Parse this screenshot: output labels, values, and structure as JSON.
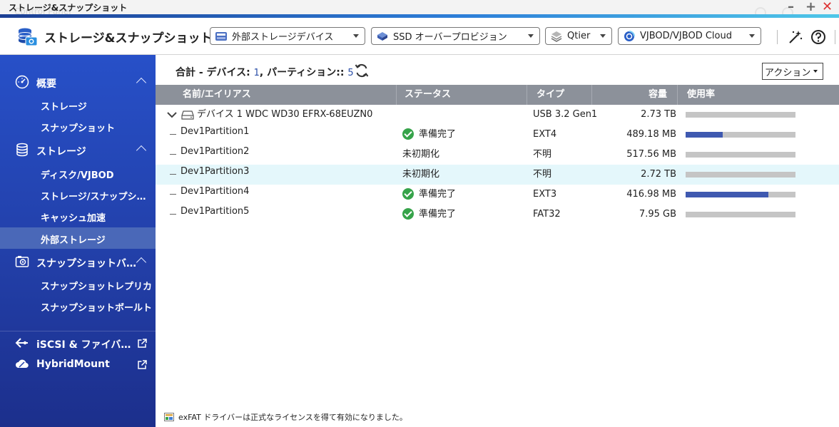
{
  "window": {
    "title": "ストレージ&スナップショット",
    "ghost_text": "Control Panel",
    "minimize": "–",
    "maximize": "+",
    "close": "✕"
  },
  "toolbar": {
    "app_name": "ストレージ&スナップショット",
    "dropdowns": [
      {
        "label": "外部ストレージデバイス",
        "icon": "external-storage-icon"
      },
      {
        "label": "SSD オーバープロビジョン",
        "icon": "ssd-icon"
      },
      {
        "label": "Qtier",
        "icon": "qtier-icon"
      },
      {
        "label": "VJBOD/VJBOD Cloud",
        "icon": "vjbod-cloud-icon"
      }
    ],
    "icons": [
      "magic-wand-icon",
      "help-icon"
    ]
  },
  "sidebar": {
    "groups": [
      {
        "label": "概要",
        "icon": "dashboard-icon",
        "items": [
          "ストレージ",
          "スナップショット"
        ]
      },
      {
        "label": "ストレージ",
        "icon": "database-icon",
        "items": [
          "ディスク/VJBOD",
          "ストレージ/スナップショット",
          "キャッシュ加速",
          "外部ストレージ"
        ]
      },
      {
        "label": "スナップショットバックアップ",
        "icon": "snapshot-camera-icon",
        "items": [
          "スナップショットレプリカ",
          "スナップショットボールト"
        ]
      }
    ],
    "active_item": "外部ストレージ",
    "links": [
      {
        "label": "iSCSI & ファイバーチャネル",
        "icon": "iscsi-icon"
      },
      {
        "label": "HybridMount",
        "icon": "cloud-icon"
      }
    ]
  },
  "summary": {
    "prefix": "合計 - デバイス:",
    "devices": "1",
    "sep": ", パーティション:",
    "colon": ":",
    "partitions": "5"
  },
  "action_label": "アクション",
  "table": {
    "columns": [
      "名前/エイリアス",
      "ステータス",
      "タイプ",
      "容量",
      "使用率"
    ],
    "device": {
      "name": "デバイス 1 WDC WD30 EFRX-68EUZN0",
      "type": "USB 3.2 Gen1",
      "capacity": "2.73 TB",
      "usage": 0
    },
    "partitions": [
      {
        "name": "Dev1Partition1",
        "status": "準備完了",
        "status_ok": true,
        "type": "EXT4",
        "capacity": "489.18 MB",
        "usage": 0.34
      },
      {
        "name": "Dev1Partition2",
        "status": "未初期化",
        "status_ok": false,
        "type": "不明",
        "capacity": "517.56 MB",
        "usage": 0
      },
      {
        "name": "Dev1Partition3",
        "status": "未初期化",
        "status_ok": false,
        "type": "不明",
        "capacity": "2.72 TB",
        "usage": 0,
        "highlighted": true
      },
      {
        "name": "Dev1Partition4",
        "status": "準備完了",
        "status_ok": true,
        "type": "EXT3",
        "capacity": "416.98 MB",
        "usage": 0.75
      },
      {
        "name": "Dev1Partition5",
        "status": "準備完了",
        "status_ok": true,
        "type": "FAT32",
        "capacity": "7.95 GB",
        "usage": 0
      }
    ]
  },
  "footer": "exFAT ドライバーは正式なライセンスを得て有効になりました。",
  "colors": {
    "sidebar_top": "#2750c8",
    "sidebar_bottom": "#1c2f8c",
    "active_item": "#4a68b8",
    "table_header": "#8c919a",
    "usage_fill": "#3f59b0",
    "usage_track": "#c5c5c5",
    "row_highlight": "#e4f7fb",
    "status_ok": "#36a34a"
  }
}
